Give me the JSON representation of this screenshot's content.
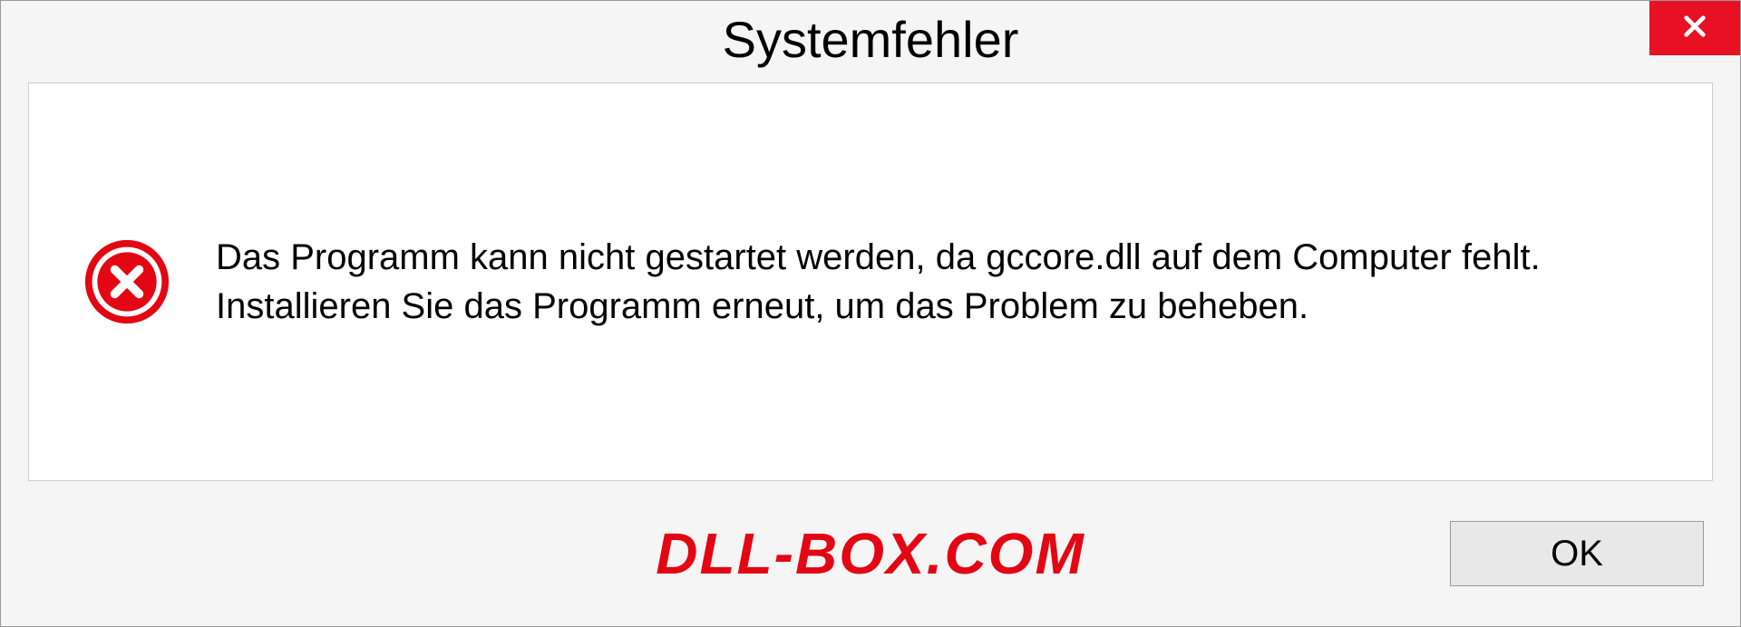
{
  "dialog": {
    "title": "Systemfehler",
    "message": "Das Programm kann nicht gestartet werden, da gccore.dll auf dem Computer fehlt. Installieren Sie das Programm erneut, um das Problem zu beheben.",
    "ok_label": "OK"
  },
  "watermark": "DLL-BOX.COM"
}
